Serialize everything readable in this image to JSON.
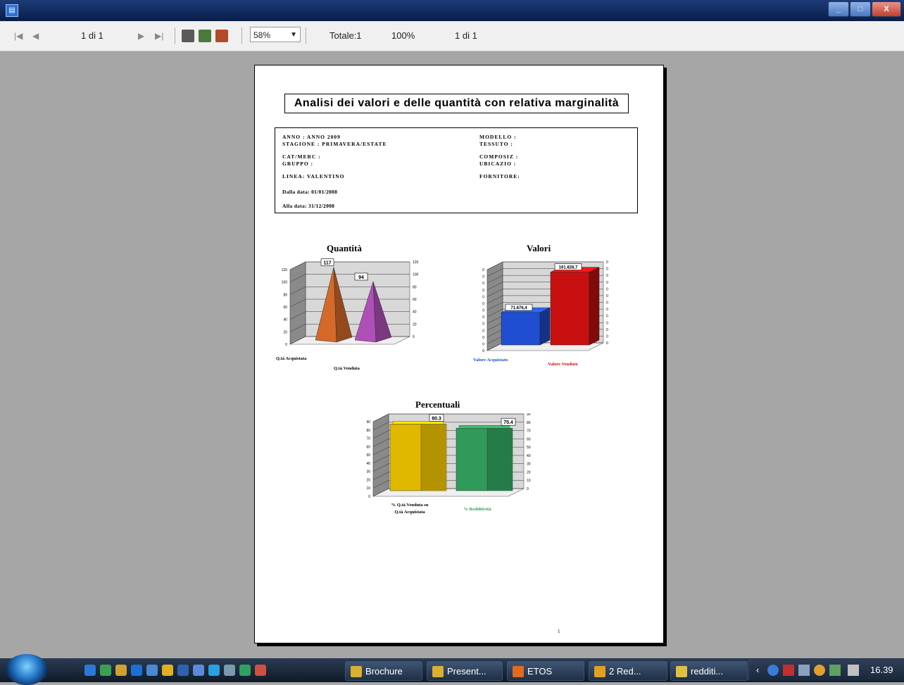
{
  "toolbar": {
    "page_indicator": "1 di 1",
    "zoom": "58%",
    "total": "Totale:1",
    "percent": "100%",
    "pages": "1 di 1"
  },
  "report": {
    "title": "Analisi dei valori e delle quantità con relativa marginalità",
    "anno": "ANNO      : ANNO 2009",
    "stagione": "STAGIONE    : PRIMAVERA/ESTATE",
    "catmerc": "CAT/MERC   :",
    "gruppo": "GRUPPO     :",
    "linea": "LINEA: VALENTINO",
    "dalla_data": "Dalla data: 01/01/2008",
    "alla_data": "Alla data: 31/12/2008",
    "modello": "MODELLO    :",
    "tessuto": "TESSUTO    :",
    "composiz": "COMPOSIZ   :",
    "ubicazio": "UBICAZIO   :",
    "fornitore": "FORNITORE:",
    "page_number": "1"
  },
  "chart_data": [
    {
      "type": "bar",
      "title": "Quantità",
      "categories": [
        "Q.tà Acquistata",
        "Q.tà Venduta"
      ],
      "values": [
        117,
        94
      ],
      "ylim": [
        0,
        120
      ],
      "yticks": [
        "0",
        "20",
        "40",
        "60",
        "80",
        "100",
        "120"
      ],
      "colors": [
        "#d4692a",
        "#b04fb7"
      ]
    },
    {
      "type": "bar",
      "title": "Valori",
      "categories": [
        "Valore Acquistato",
        "Valore Venduto"
      ],
      "values": [
        71876.4,
        161828.7
      ],
      "value_labels": [
        "71.876,4",
        "161.828,7"
      ],
      "colors": [
        "#1f4fd0",
        "#c81010"
      ]
    },
    {
      "type": "bar",
      "title": "Percentuali",
      "categories": [
        "% Q.tà Venduta su Q.tà Acquistata",
        "% Redditività"
      ],
      "values": [
        80.3,
        75.4
      ],
      "ylim": [
        0,
        90
      ],
      "yticks": [
        "0",
        "10",
        "20",
        "30",
        "40",
        "50",
        "60",
        "70",
        "80",
        "90"
      ],
      "colors": [
        "#e0b800",
        "#2f9a5a"
      ]
    }
  ],
  "taskbar": {
    "items": [
      "Brochure",
      "Present...",
      "ETOS",
      "2 Red...",
      "redditi..."
    ],
    "clock": "16.39"
  },
  "colors": {
    "titlebar": "#102a5c",
    "workspace": "#a6a6a6",
    "taskbar": "#1a2638"
  }
}
